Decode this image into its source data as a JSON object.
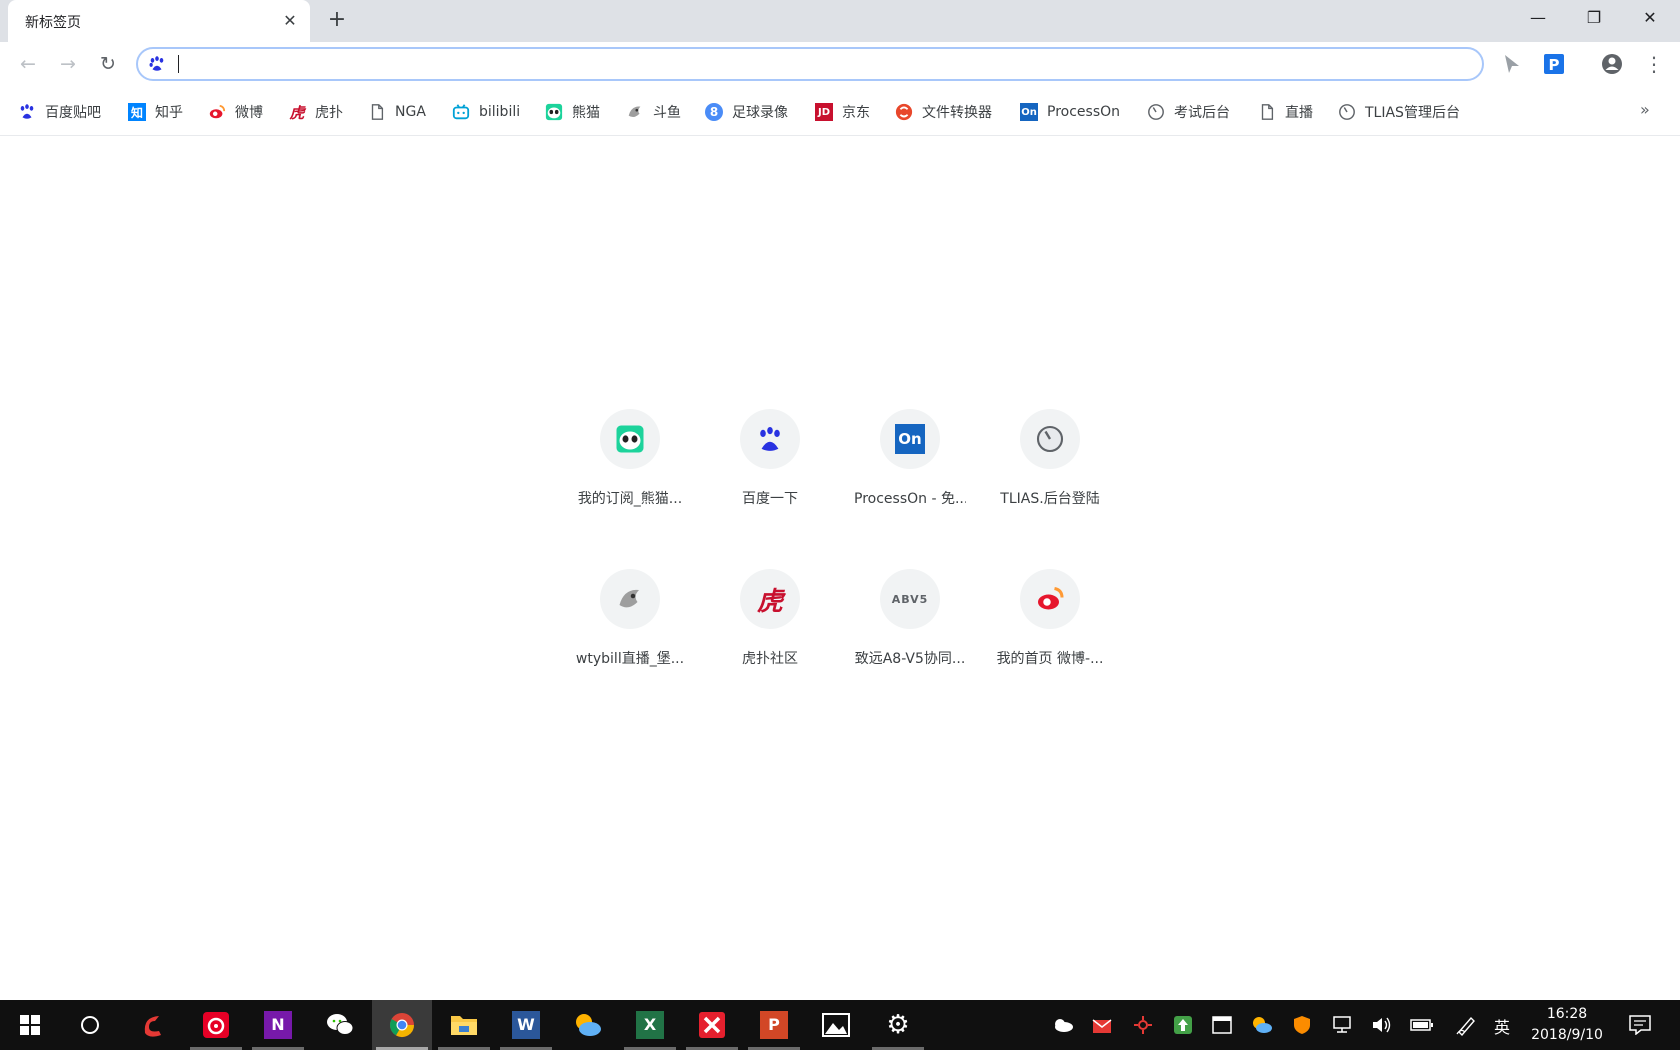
{
  "browser": {
    "tab_title": "新标签页",
    "tab_close": "✕",
    "new_tab": "+",
    "window": {
      "minimize": "—",
      "restore": "❐",
      "close": "✕"
    }
  },
  "toolbar": {
    "omnibox_value": "",
    "menu_glyph": "⋮",
    "back_glyph": "←",
    "forward_glyph": "→",
    "reload_glyph": "↻"
  },
  "bookmarks": {
    "items": [
      {
        "label": "百度贴吧",
        "icon": "baidu-paw-icon"
      },
      {
        "label": "知乎",
        "icon": "zhihu-icon",
        "glyph": "知"
      },
      {
        "label": "微博",
        "icon": "weibo-icon"
      },
      {
        "label": "虎扑",
        "icon": "hupu-icon",
        "glyph": "虎"
      },
      {
        "label": "NGA",
        "icon": "page-icon"
      },
      {
        "label": "bilibili",
        "icon": "bilibili-icon"
      },
      {
        "label": "熊猫",
        "icon": "panda-icon"
      },
      {
        "label": "斗鱼",
        "icon": "douyu-icon"
      },
      {
        "label": "足球录像",
        "icon": "football-icon",
        "glyph": "8"
      },
      {
        "label": "京东",
        "icon": "jd-icon",
        "glyph": "JD"
      },
      {
        "label": "文件转换器",
        "icon": "converter-icon"
      },
      {
        "label": "ProcessOn",
        "icon": "processon-icon",
        "glyph": "On"
      },
      {
        "label": "考试后台",
        "icon": "gauge-icon"
      },
      {
        "label": "直播",
        "icon": "page-icon"
      },
      {
        "label": "TLIAS管理后台",
        "icon": "gauge-icon"
      }
    ],
    "more": "»"
  },
  "most_visited": [
    {
      "title": "我的订阅_熊猫...",
      "icon": "panda-icon"
    },
    {
      "title": "百度一下",
      "icon": "baidu-paw-icon",
      "glyph": "du"
    },
    {
      "title": "ProcessOn - 免...",
      "icon": "processon-icon",
      "glyph": "On"
    },
    {
      "title": "TLIAS.后台登陆",
      "icon": "gauge-icon"
    },
    {
      "title": "wtybill直播_堡...",
      "icon": "douyu-icon"
    },
    {
      "title": "虎扑社区",
      "icon": "hupu-icon",
      "glyph": "虎"
    },
    {
      "title": "致远A8-V5协同...",
      "icon": "seeyon-icon",
      "glyph": "ABV5"
    },
    {
      "title": "我的首页 微博-...",
      "icon": "weibo-icon"
    }
  ],
  "taskbar": {
    "time": "16:28",
    "date": "2018/9/10",
    "ime": "英",
    "apps": [
      {
        "name": "start-button",
        "icon": "windows-logo-icon"
      },
      {
        "name": "cortana-button",
        "icon": "cortana-circle-icon"
      },
      {
        "name": "app-red-swirl",
        "icon": "red-swirl-icon"
      },
      {
        "name": "app-netease-music",
        "icon": "netease-music-icon"
      },
      {
        "name": "app-onenote",
        "icon": "onenote-icon",
        "glyph": "N"
      },
      {
        "name": "app-wechat",
        "icon": "wechat-icon"
      },
      {
        "name": "app-chrome",
        "icon": "chrome-icon"
      },
      {
        "name": "app-file-explorer",
        "icon": "folder-icon"
      },
      {
        "name": "app-word",
        "icon": "word-icon",
        "glyph": "W"
      },
      {
        "name": "app-weather",
        "icon": "weather-icon"
      },
      {
        "name": "app-excel",
        "icon": "excel-icon",
        "glyph": "X"
      },
      {
        "name": "app-xmind",
        "icon": "xmind-icon"
      },
      {
        "name": "app-powerpoint",
        "icon": "powerpoint-icon",
        "glyph": "P"
      },
      {
        "name": "app-photos",
        "icon": "photos-icon"
      },
      {
        "name": "app-settings",
        "icon": "gear-icon",
        "glyph": "⚙"
      }
    ]
  },
  "colors": {
    "accent": "#1a73e8",
    "tabstrip": "#dee1e6",
    "taskbar": "#101010"
  }
}
